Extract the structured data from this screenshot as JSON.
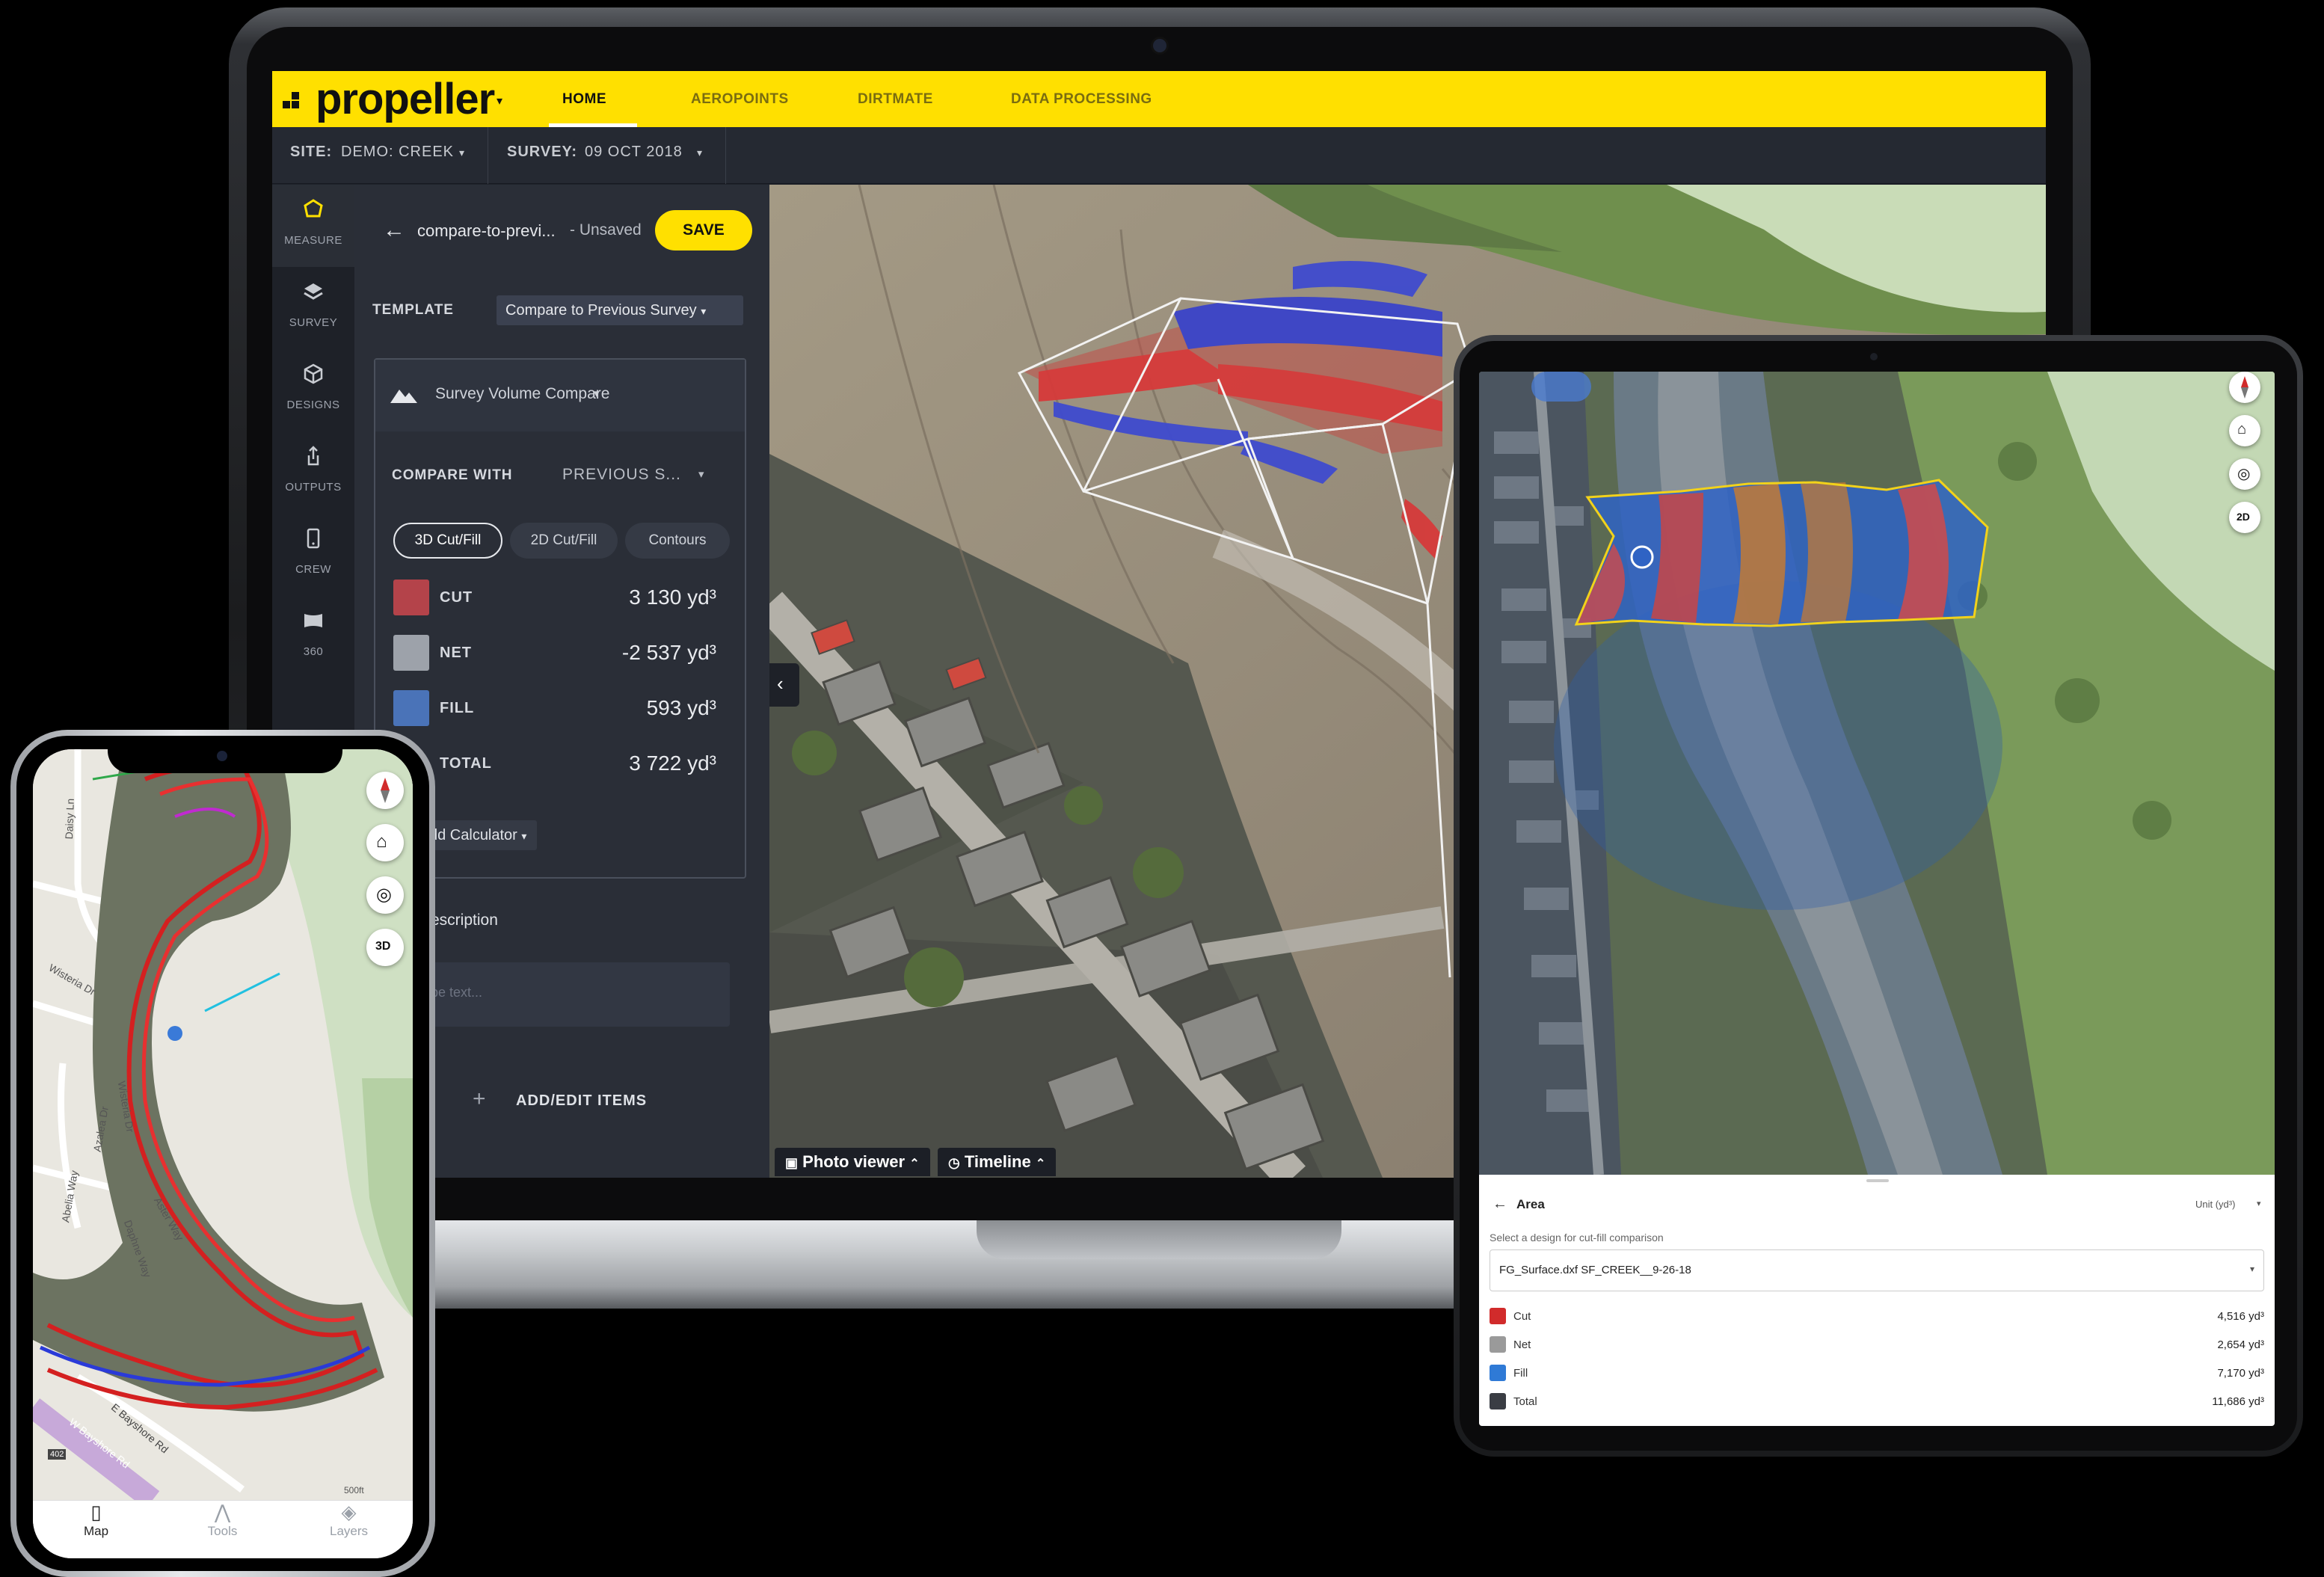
{
  "app": {
    "brand": "propeller",
    "nav_tabs": [
      "HOME",
      "AEROPOINTS",
      "DIRTMATE",
      "DATA PROCESSING"
    ],
    "active_tab": "HOME",
    "site_label": "SITE:",
    "site_value": "DEMO: CREEK",
    "survey_label": "SURVEY:",
    "survey_value": "09 OCT 2018"
  },
  "rail": [
    {
      "label": "MEASURE",
      "icon": "hexagon-icon"
    },
    {
      "label": "SURVEY",
      "icon": "layers-icon"
    },
    {
      "label": "DESIGNS",
      "icon": "cube-icon"
    },
    {
      "label": "OUTPUTS",
      "icon": "share-icon"
    },
    {
      "label": "CREW",
      "icon": "phone-icon"
    },
    {
      "label": "360",
      "icon": "panorama-icon"
    }
  ],
  "panel": {
    "title": "compare-to-previ...",
    "status": "- Unsaved",
    "save_label": "SAVE",
    "template_label": "TEMPLATE",
    "template_value": "Compare to Previous Survey",
    "calc_title": "Survey Volume Compare",
    "compare_label": "COMPARE WITH",
    "compare_value": "PREVIOUS S...",
    "segments": [
      "3D Cut/Fill",
      "2D Cut/Fill",
      "Contours"
    ],
    "rows": [
      {
        "label": "CUT",
        "value": "3 130 yd³",
        "color": "#b4434a"
      },
      {
        "label": "NET",
        "value": "-2 537 yd³",
        "color": "#9da2aa"
      },
      {
        "label": "FILL",
        "value": "593 yd³",
        "color": "#4a73b8"
      },
      {
        "label": "TOTAL",
        "value": "3 722 yd³",
        "color": ""
      }
    ],
    "add_calculator": "dd Calculator",
    "description_label": "escription",
    "description_placeholder": "pe text...",
    "add_edit": "ADD/EDIT ITEMS"
  },
  "map_bar": {
    "photo_viewer": "Photo viewer",
    "timeline": "Timeline"
  },
  "tablet": {
    "back_title": "Area",
    "unit": "Unit (yd³)",
    "hint": "Select a design for cut-fill comparison",
    "design": "FG_Surface.dxf SF_CREEK__9-26-18",
    "rows": [
      {
        "label": "Cut",
        "value": "4,516 yd³",
        "color": "#d12b2b"
      },
      {
        "label": "Net",
        "value": "2,654 yd³",
        "color": "#9a9a9a"
      },
      {
        "label": "Fill",
        "value": "7,170 yd³",
        "color": "#2f7ad6"
      },
      {
        "label": "Total",
        "value": "11,686 yd³",
        "color": "#3a3d44"
      }
    ],
    "btn_2d": "2D"
  },
  "phone": {
    "btn_3d": "3D",
    "streets": [
      "Daisy Ln",
      "Wisteria Dr",
      "Abelia Way",
      "Azalea Dr",
      "Wisteria Dr",
      "Daphne Way",
      "Aster Way",
      "E Bayshore Rd",
      "W Bayshore Rd",
      "402"
    ],
    "scale": "500ft",
    "tabs": [
      "Map",
      "Tools",
      "Layers"
    ]
  }
}
